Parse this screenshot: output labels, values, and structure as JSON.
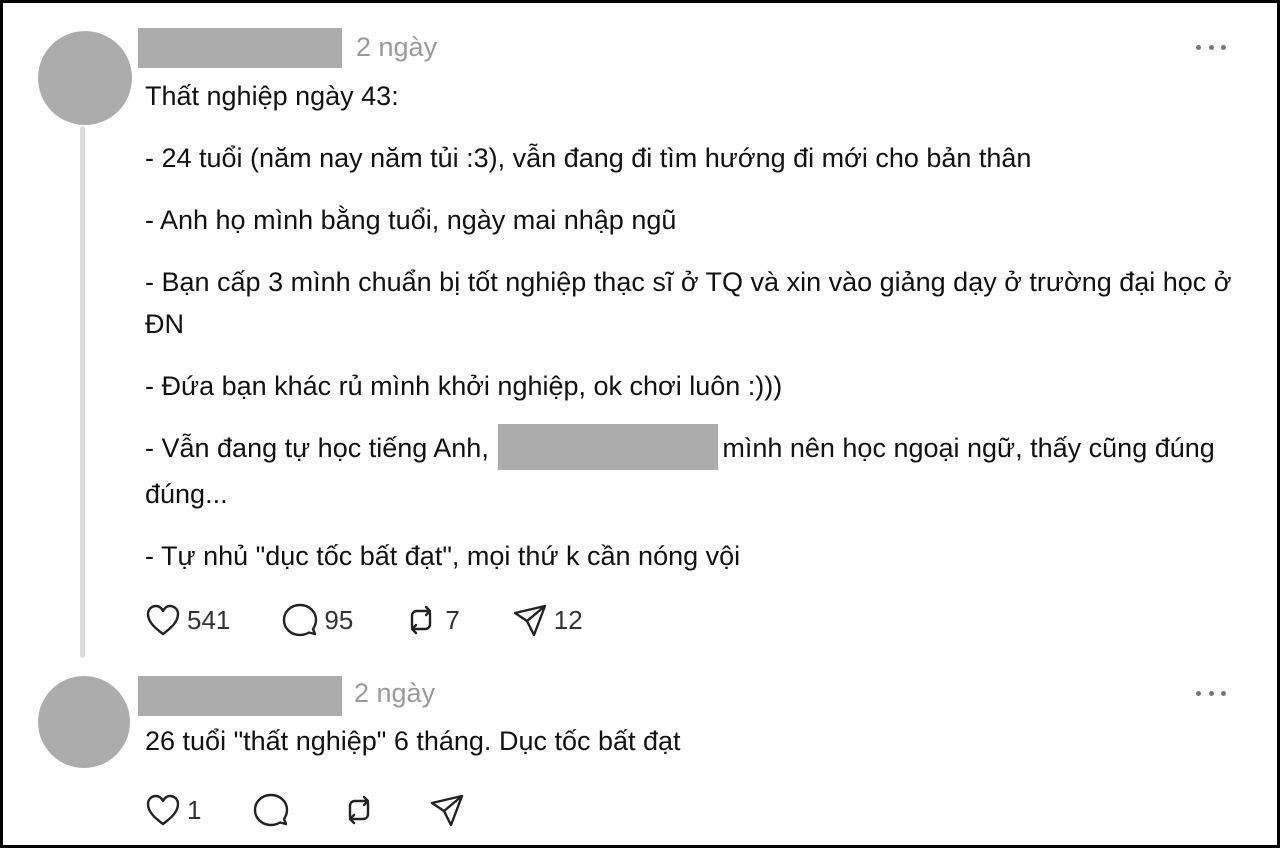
{
  "posts": [
    {
      "time": "2 ngày",
      "lines": {
        "l1": "Thất nghiệp ngày 43:",
        "l2": "- 24 tuổi (năm nay năm tủi :3), vẫn đang đi tìm hướng đi mới cho bản thân",
        "l3": "- Anh họ mình bằng tuổi, ngày mai nhập ngũ",
        "l4": "- Bạn cấp 3 mình chuẩn bị tốt nghiệp thạc sĩ ở TQ và xin vào giảng dạy ở trường đại học ở ĐN",
        "l5": "- Đứa bạn khác rủ mình khởi nghiệp, ok chơi luôn :)))",
        "l6a": "- Vẫn đang tự học tiếng Anh,",
        "l6b": "mình nên học ngoại ngữ, thấy cũng đúng đúng...",
        "l7": "- Tự nhủ \"dục tốc bất đạt\", mọi thứ k cần nóng vội"
      },
      "stats": {
        "likes": "541",
        "comments": "95",
        "reposts": "7",
        "shares": "12"
      }
    },
    {
      "time": "2 ngày",
      "text": "26 tuổi \"thất nghiệp\" 6 tháng. Dục tốc bất đạt",
      "stats": {
        "likes": "1"
      }
    }
  ],
  "icons": [
    "heart-icon",
    "comment-icon",
    "repost-icon",
    "share-icon",
    "more-icon"
  ],
  "colors": {
    "placeholder": "#acacac",
    "muted": "#9a9a9a",
    "thread_line": "#dcdcdc"
  }
}
